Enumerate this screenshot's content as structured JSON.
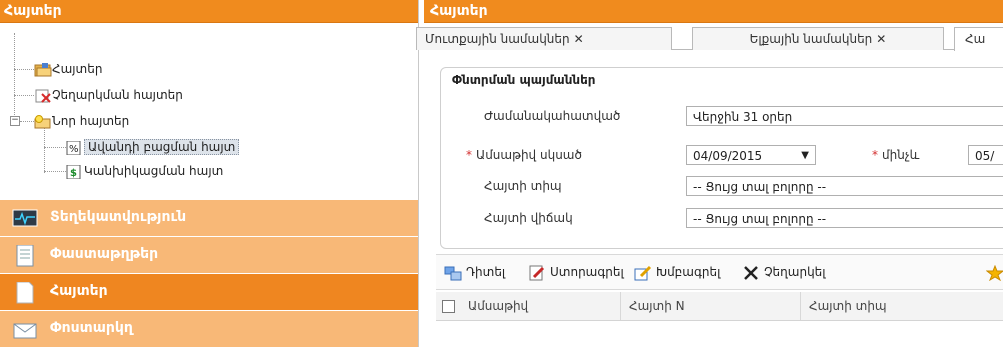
{
  "left": {
    "header": "Հայտեր",
    "tree": [
      {
        "label": "Հայտեր",
        "icon": "folder-open-icon"
      },
      {
        "label": "Չեղարկման հայտեր",
        "icon": "cancel-document-icon"
      },
      {
        "label": "Նոր հայտեր",
        "icon": "new-folder-icon"
      },
      {
        "label": "Ավանդի բացման հայտ",
        "icon": "percent-document-icon"
      },
      {
        "label": "Կանխիկացման հայտ",
        "icon": "dollar-document-icon"
      }
    ],
    "tree_expander": "−",
    "menu": [
      {
        "label": "Տեղեկատվություն",
        "icon": "monitor-icon"
      },
      {
        "label": "Փաստաթղթեր",
        "icon": "documents-icon"
      },
      {
        "label": "Հայտեր",
        "icon": "page-icon"
      },
      {
        "label": "Փոստարկղ",
        "icon": "mail-icon"
      }
    ]
  },
  "right": {
    "header": "Հայտեր",
    "tabs": [
      {
        "label": "Մուտքային նամակներ",
        "close": "✕"
      },
      {
        "label": "Ելքային նամակներ",
        "close": "✕"
      },
      {
        "label": "Հա"
      }
    ],
    "filter": {
      "title": "Փնտրման պայմաններ",
      "period_label": "Ժամանակահատված",
      "period_value": "Վերջին 31 օրեր",
      "date_from_label": "Ամսաթիվ սկսած",
      "date_from_value": "04/09/2015",
      "date_to_label": "մինչև",
      "date_to_value": "05/",
      "required_mark": "*",
      "type_label": "Հայտի տիպ",
      "type_value": "-- Ցույց տալ բոլորը --",
      "status_label": "Հայտի վիճակ",
      "status_value": "-- Ցույց տալ բոլորը --",
      "dropdown_arrow": "▼"
    },
    "toolbar": [
      {
        "label": "Դիտել",
        "icon": "view-icon"
      },
      {
        "label": "Ստորագրել",
        "icon": "sign-icon"
      },
      {
        "label": "Խմբագրել",
        "icon": "edit-icon"
      },
      {
        "label": "Չեղարկել",
        "icon": "cancel-icon"
      }
    ],
    "grid_columns": [
      "Ամսաթիվ",
      "Հայտի N",
      "Հայտի տիպ"
    ]
  },
  "colors": {
    "accent": "#ef8620",
    "accent_light": "#f8b877"
  }
}
